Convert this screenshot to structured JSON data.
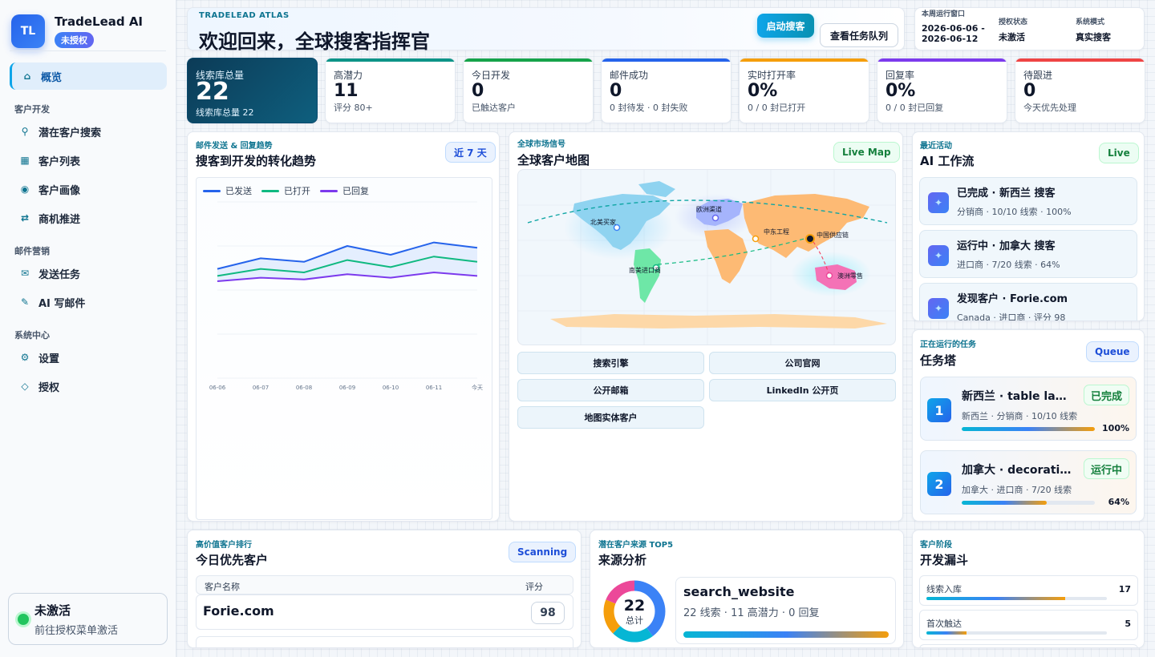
{
  "sidebar": {
    "brand": {
      "initials": "TL",
      "name": "TradeLead AI",
      "badge": "未授权"
    },
    "nav": [
      {
        "label": "概览",
        "icon": "home-icon",
        "glyph": "⌂"
      },
      {
        "label": "潜在客户搜索",
        "icon": "key-search-icon",
        "glyph": "⚲"
      },
      {
        "label": "客户列表",
        "icon": "grid-icon",
        "glyph": "▦"
      },
      {
        "label": "客户画像",
        "icon": "target-icon",
        "glyph": "◉"
      },
      {
        "label": "商机推进",
        "icon": "exchange-icon",
        "glyph": "⇄"
      },
      {
        "label": "发送任务",
        "icon": "mail-icon",
        "glyph": "✉"
      },
      {
        "label": "AI 写邮件",
        "icon": "pen-icon",
        "glyph": "✎"
      },
      {
        "label": "设置",
        "icon": "gear-icon",
        "glyph": "⚙"
      },
      {
        "label": "授权",
        "icon": "diamond-icon",
        "glyph": "◇"
      }
    ],
    "sections": {
      "dev": "客户开发",
      "mail": "邮件营销",
      "system": "系统中心"
    },
    "license": {
      "title": "未激活",
      "subtitle": "前往授权菜单激活"
    }
  },
  "header": {
    "kicker": "TRADELEAD ATLAS",
    "title": "欢迎回来，全球搜客指挥官",
    "start_button": "启动搜客",
    "queue_button": "查看任务队列"
  },
  "info": {
    "window_label": "本周运行窗口",
    "window_value": "2026-06-06 - 2026-06-12",
    "auth_label": "授权状态",
    "auth_value": "未激活",
    "mode_label": "系统模式",
    "mode_value": "真实搜客"
  },
  "stats": [
    {
      "label": "线索库总量",
      "value": "22",
      "sub": "线索库总量 22",
      "color": "#0c4a6e"
    },
    {
      "label": "高潜力",
      "value": "11",
      "sub": "评分 80+",
      "color": "#0d9488"
    },
    {
      "label": "今日开发",
      "value": "0",
      "sub": "已触达客户",
      "color": "#16a34a"
    },
    {
      "label": "邮件成功",
      "value": "0",
      "sub": "0 封待发 · 0 封失败",
      "color": "#2563eb"
    },
    {
      "label": "实时打开率",
      "value": "0%",
      "sub": "0 / 0 封已打开",
      "color": "#f59e0b"
    },
    {
      "label": "回复率",
      "value": "0%",
      "sub": "0 / 0 封已回复",
      "color": "#7c3aed"
    },
    {
      "label": "待跟进",
      "value": "0",
      "sub": "今天优先处理",
      "color": "#ef4444"
    }
  ],
  "trend": {
    "kicker": "邮件发送 & 回复趋势",
    "title": "搜客到开发的转化趋势",
    "range": "近 7 天"
  },
  "chart_data": {
    "type": "line",
    "categories": [
      "06-06",
      "06-07",
      "06-08",
      "06-09",
      "06-10",
      "06-11",
      "今天"
    ],
    "series": [
      {
        "name": "已发送",
        "values": [
          62,
          68,
          66,
          75,
          70,
          77,
          74
        ],
        "color": "#2563eb"
      },
      {
        "name": "已打开",
        "values": [
          58,
          62,
          60,
          67,
          63,
          69,
          66
        ],
        "color": "#10b981"
      },
      {
        "name": "已回复",
        "values": [
          55,
          57,
          56,
          59,
          57,
          60,
          58
        ],
        "color": "#7c3aed"
      }
    ],
    "ylim": [
      0,
      100
    ],
    "grid": true,
    "legend": "top-left"
  },
  "map": {
    "kicker": "全球市场信号",
    "title": "全球客户地图",
    "button": "Live Map",
    "labels": {
      "na": "北美买家",
      "eu": "欧洲渠道",
      "me": "中东工程",
      "cn": "中国供应链",
      "sa": "南美进口商",
      "au": "澳洲零售"
    },
    "sources": [
      "搜索引擎",
      "公司官网",
      "公开邮箱",
      "LinkedIn 公开页",
      "地图实体客户"
    ]
  },
  "activity": {
    "kicker": "最近活动",
    "title": "AI 工作流",
    "button": "Live",
    "items": [
      {
        "title": "已完成 · 新西兰 搜客",
        "sub": "分销商 · 10/10 线索 · 100%"
      },
      {
        "title": "运行中 · 加拿大 搜客",
        "sub": "进口商 · 7/20 线索 · 64%"
      },
      {
        "title": "发现客户 · Forie.com",
        "sub": "Canada · 进口商 · 评分 98"
      }
    ]
  },
  "tasks": {
    "kicker": "正在运行的任务",
    "title": "任务塔",
    "button": "Queue",
    "items": [
      {
        "num": "1",
        "title": "新西兰 · table lamp...",
        "status": "已完成",
        "sub": "新西兰 · 分销商 · 10/10 线索",
        "progress": 1.0,
        "pct": "100%"
      },
      {
        "num": "2",
        "title": "加拿大 · decorative...",
        "status": "运行中",
        "sub": "加拿大 · 进口商 · 7/20 线索",
        "progress": 0.64,
        "pct": "64%"
      }
    ]
  },
  "priority": {
    "kicker": "高价值客户排行",
    "title": "今日优先客户",
    "button": "Scanning",
    "col_name": "客户名称",
    "col_score": "评分",
    "rows": [
      {
        "name": "Forie.com",
        "score": "98"
      }
    ]
  },
  "source": {
    "kicker": "潜在客户来源 TOP5",
    "title": "来源分析",
    "total": "22",
    "total_label": "总计",
    "top_name": "search_website",
    "top_sub": "22 线索 · 11 高潜力 · 0 回复"
  },
  "funnel": {
    "kicker": "客户阶段",
    "title": "开发漏斗",
    "rows": [
      {
        "label": "线索入库",
        "count": "17",
        "fraction": 0.77
      },
      {
        "label": "首次触达",
        "count": "5",
        "fraction": 0.22
      }
    ]
  }
}
